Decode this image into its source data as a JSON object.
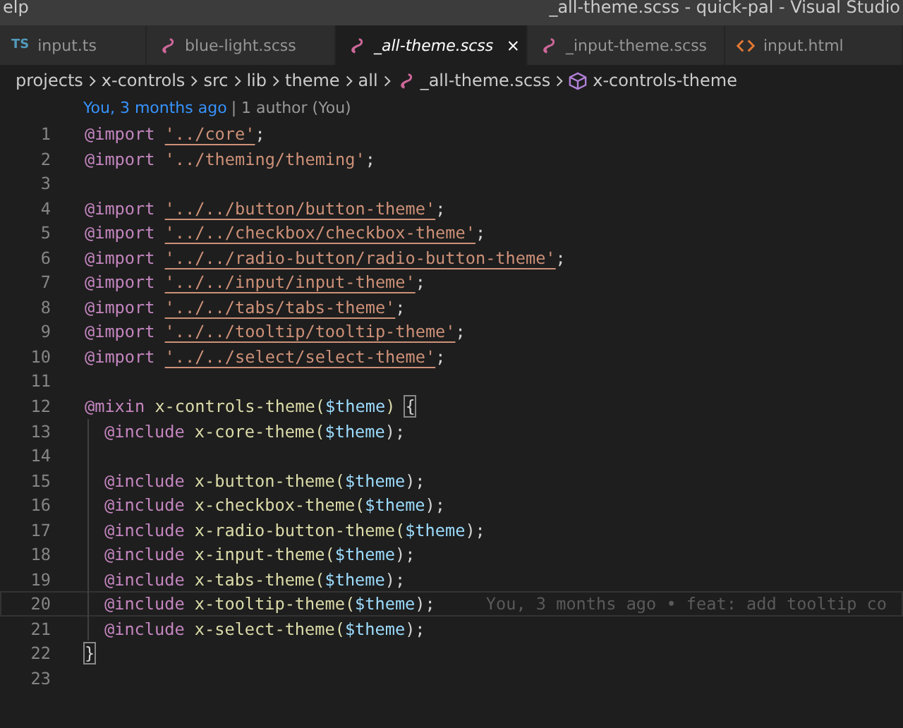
{
  "menu": {
    "label": "elp"
  },
  "window": {
    "title": "_all-theme.scss - quick-pal - Visual Studio"
  },
  "tabs": [
    {
      "kind": "ts",
      "icon_text": "TS",
      "label": "input.ts",
      "selected": false,
      "italic": false
    },
    {
      "kind": "scss",
      "label": "blue-light.scss",
      "selected": false,
      "italic": false
    },
    {
      "kind": "scss",
      "label": "_all-theme.scss",
      "selected": true,
      "italic": true
    },
    {
      "kind": "scss",
      "label": "_input-theme.scss",
      "selected": false,
      "italic": false
    },
    {
      "kind": "html",
      "label": "input.html",
      "selected": false,
      "italic": false
    }
  ],
  "breadcrumb": [
    {
      "kind": "folder",
      "label": "projects"
    },
    {
      "kind": "folder",
      "label": "x-controls"
    },
    {
      "kind": "folder",
      "label": "src"
    },
    {
      "kind": "folder",
      "label": "lib"
    },
    {
      "kind": "folder",
      "label": "theme"
    },
    {
      "kind": "folder",
      "label": "all"
    },
    {
      "kind": "scss",
      "label": "_all-theme.scss"
    },
    {
      "kind": "symbol",
      "label": "x-controls-theme"
    }
  ],
  "codelens": {
    "author": "You, 3 months ago",
    "rest": "| 1 author (You)"
  },
  "lines": [
    {
      "n": "1",
      "indented": false,
      "current": false,
      "tokens": [
        {
          "kind": "at",
          "text": "@import"
        },
        {
          "kind": "link",
          "text": "'../core'",
          "space": true
        },
        {
          "kind": "punct",
          "text": ";"
        }
      ]
    },
    {
      "n": "2",
      "indented": false,
      "current": false,
      "tokens": [
        {
          "kind": "at",
          "text": "@import"
        },
        {
          "kind": "string",
          "text": "'../theming/theming'",
          "space": true
        },
        {
          "kind": "punct",
          "text": ";"
        }
      ]
    },
    {
      "n": "3",
      "indented": false,
      "current": false
    },
    {
      "n": "4",
      "indented": false,
      "current": false,
      "tokens": [
        {
          "kind": "at",
          "text": "@import"
        },
        {
          "kind": "link",
          "text": "'../../button/button-theme'",
          "space": true
        },
        {
          "kind": "punct",
          "text": ";"
        }
      ]
    },
    {
      "n": "5",
      "indented": false,
      "current": false,
      "tokens": [
        {
          "kind": "at",
          "text": "@import"
        },
        {
          "kind": "link",
          "text": "'../../checkbox/checkbox-theme'",
          "space": true
        },
        {
          "kind": "punct",
          "text": ";"
        }
      ]
    },
    {
      "n": "6",
      "indented": false,
      "current": false,
      "tokens": [
        {
          "kind": "at",
          "text": "@import"
        },
        {
          "kind": "link",
          "text": "'../../radio-button/radio-button-theme'",
          "space": true
        },
        {
          "kind": "punct",
          "text": ";"
        }
      ]
    },
    {
      "n": "7",
      "indented": false,
      "current": false,
      "tokens": [
        {
          "kind": "at",
          "text": "@import"
        },
        {
          "kind": "link",
          "text": "'../../input/input-theme'",
          "space": true
        },
        {
          "kind": "punct",
          "text": ";"
        }
      ]
    },
    {
      "n": "8",
      "indented": false,
      "current": false,
      "tokens": [
        {
          "kind": "at",
          "text": "@import"
        },
        {
          "kind": "link",
          "text": "'../../tabs/tabs-theme'",
          "space": true
        },
        {
          "kind": "punct",
          "text": ";"
        }
      ]
    },
    {
      "n": "9",
      "indented": false,
      "current": false,
      "tokens": [
        {
          "kind": "at",
          "text": "@import"
        },
        {
          "kind": "link",
          "text": "'../../tooltip/tooltip-theme'",
          "space": true
        },
        {
          "kind": "punct",
          "text": ";"
        }
      ]
    },
    {
      "n": "10",
      "indented": false,
      "current": false,
      "tokens": [
        {
          "kind": "at",
          "text": "@import"
        },
        {
          "kind": "link",
          "text": "'../../select/select-theme'",
          "space": true
        },
        {
          "kind": "punct",
          "text": ";"
        }
      ]
    },
    {
      "n": "11",
      "indented": false,
      "current": false
    },
    {
      "n": "12",
      "indented": false,
      "current": false,
      "tokens": [
        {
          "kind": "at",
          "text": "@mixin"
        },
        {
          "kind": "fn",
          "text": "x-controls-theme(",
          "space": true
        },
        {
          "kind": "var",
          "text": "$theme"
        },
        {
          "kind": "fn",
          "text": ")"
        },
        {
          "kind": "bracket",
          "text": "{",
          "space": true
        }
      ]
    },
    {
      "n": "13",
      "indented": true,
      "current": false,
      "tokens": [
        {
          "kind": "at",
          "text": "@include"
        },
        {
          "kind": "fn",
          "text": "x-core-theme(",
          "space": true
        },
        {
          "kind": "var",
          "text": "$theme"
        },
        {
          "kind": "punct",
          "text": ");"
        }
      ]
    },
    {
      "n": "14",
      "indented": true,
      "current": false
    },
    {
      "n": "15",
      "indented": true,
      "current": false,
      "tokens": [
        {
          "kind": "at",
          "text": "@include"
        },
        {
          "kind": "fn",
          "text": "x-button-theme(",
          "space": true
        },
        {
          "kind": "var",
          "text": "$theme"
        },
        {
          "kind": "punct",
          "text": ");"
        }
      ]
    },
    {
      "n": "16",
      "indented": true,
      "current": false,
      "tokens": [
        {
          "kind": "at",
          "text": "@include"
        },
        {
          "kind": "fn",
          "text": "x-checkbox-theme(",
          "space": true
        },
        {
          "kind": "var",
          "text": "$theme"
        },
        {
          "kind": "punct",
          "text": ");"
        }
      ]
    },
    {
      "n": "17",
      "indented": true,
      "current": false,
      "tokens": [
        {
          "kind": "at",
          "text": "@include"
        },
        {
          "kind": "fn",
          "text": "x-radio-button-theme(",
          "space": true
        },
        {
          "kind": "var",
          "text": "$theme"
        },
        {
          "kind": "punct",
          "text": ");"
        }
      ]
    },
    {
      "n": "18",
      "indented": true,
      "current": false,
      "tokens": [
        {
          "kind": "at",
          "text": "@include"
        },
        {
          "kind": "fn",
          "text": "x-input-theme(",
          "space": true
        },
        {
          "kind": "var",
          "text": "$theme"
        },
        {
          "kind": "punct",
          "text": ");"
        }
      ]
    },
    {
      "n": "19",
      "indented": true,
      "current": false,
      "tokens": [
        {
          "kind": "at",
          "text": "@include"
        },
        {
          "kind": "fn",
          "text": "x-tabs-theme(",
          "space": true
        },
        {
          "kind": "var",
          "text": "$theme"
        },
        {
          "kind": "punct",
          "text": ");"
        }
      ]
    },
    {
      "n": "20",
      "indented": true,
      "current": true,
      "blame": "You, 3 months ago • feat: add tooltip co",
      "tokens": [
        {
          "kind": "at",
          "text": "@include"
        },
        {
          "kind": "fn",
          "text": "x-tooltip-theme(",
          "space": true
        },
        {
          "kind": "var",
          "text": "$theme"
        },
        {
          "kind": "punct",
          "text": ");"
        }
      ]
    },
    {
      "n": "21",
      "indented": true,
      "current": false,
      "tokens": [
        {
          "kind": "at",
          "text": "@include"
        },
        {
          "kind": "fn",
          "text": "x-select-theme(",
          "space": true
        },
        {
          "kind": "var",
          "text": "$theme"
        },
        {
          "kind": "punct",
          "text": ");"
        }
      ]
    },
    {
      "n": "22",
      "indented": false,
      "current": false,
      "tokens": [
        {
          "kind": "bracket",
          "text": "}"
        }
      ]
    },
    {
      "n": "23",
      "indented": false,
      "current": false
    }
  ]
}
